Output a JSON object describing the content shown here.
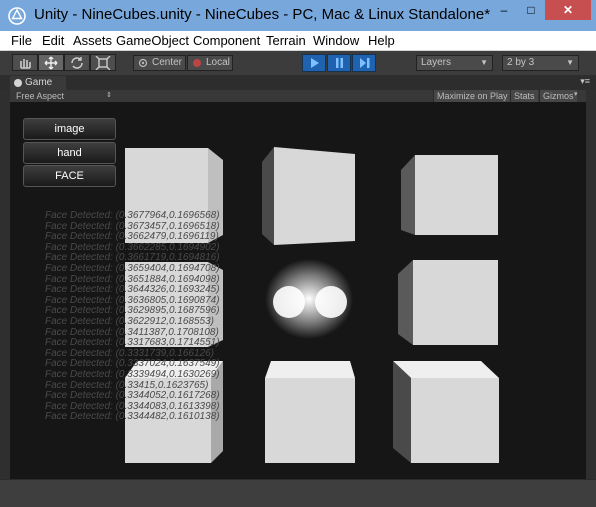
{
  "window": {
    "title": "Unity - NineCubes.unity - NineCubes - PC, Mac & Linux Standalone*",
    "minimize": "–",
    "maximize": "□",
    "close": "✕"
  },
  "menu": [
    "File",
    "Edit",
    "Assets",
    "GameObject",
    "Component",
    "Terrain",
    "Window",
    "Help"
  ],
  "toolbar": {
    "tools": [
      "hand-tool-icon",
      "move-tool-icon",
      "rotate-tool-icon",
      "scale-tool-icon"
    ],
    "pivot_label": "Center",
    "space_label": "Local",
    "layers_label": "Layers",
    "layout_label": "2 by 3"
  },
  "game_view": {
    "tab_label": "Game",
    "aspect": "Free Aspect",
    "maximize_on_play": "Maximize on Play",
    "stats": "Stats",
    "gizmos": "Gizmos"
  },
  "gui_buttons": [
    "image",
    "hand",
    "FACE"
  ],
  "log_lines": [
    "Face Detected: (0.3677964,0.1696568)",
    "Face Detected: (0.3673457,0.1696518)",
    "Face Detected: (0.3662479,0.1696119)",
    "Face Detected: (0.3662285,0.1694902)",
    "Face Detected: (0.3661719,0.1694816)",
    "Face Detected: (0.3659404,0.1694708)",
    "Face Detected: (0.3651884,0.1694098)",
    "Face Detected: (0.3644326,0.1693245)",
    "Face Detected: (0.3636805,0.1690874)",
    "Face Detected: (0.3629895,0.1687596)",
    "Face Detected: (0.3622912,0.168553)",
    "Face Detected: (0.3411387,0.1708108)",
    "Face Detected: (0.3317683,0.1714551)",
    "Face Detected: (0.3331739,0.166126)",
    "Face Detected: (0.3337024,0.1637549)",
    "Face Detected: (0.3339494,0.1630269)",
    "Face Detected: (0.33415,0.1623765)",
    "Face Detected: (0.3344052,0.1617268)",
    "Face Detected: (0.3344083,0.1613398)",
    "Face Detected: (0.3344482,0.1610138)"
  ],
  "colors": {
    "title_bar": "#78a7dc",
    "play_button": "#1f62b0",
    "cube_face": "#d8d8d8",
    "viewport": "#161616"
  }
}
